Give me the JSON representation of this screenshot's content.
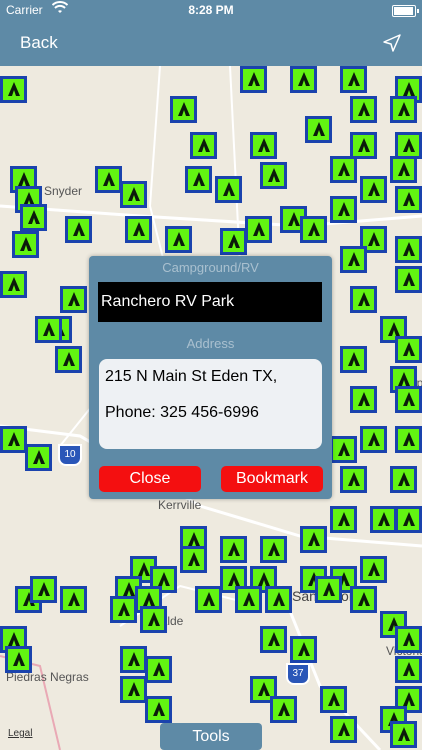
{
  "status_bar": {
    "carrier": "Carrier",
    "time": "8:28 PM",
    "battery_level": 0.95
  },
  "nav": {
    "back_label": "Back",
    "location_icon": "location-arrow-icon"
  },
  "map": {
    "labels": {
      "snyder": "Snyder",
      "kerrville": "Kerrville",
      "uvalde": "Uvalde",
      "san_antonio": "San Antonio",
      "piedras_negras": "Piedras Negras",
      "victoria": "Victoria",
      "temple": "Temple",
      "i10": "10",
      "us37": "37"
    },
    "pin_icon": "campground-tent-icon",
    "colors": {
      "pin_fill": "#62f312",
      "pin_border": "#1a43ad",
      "map_bg": "#eeeadf"
    }
  },
  "dialog": {
    "campground_caption": "Campground/RV",
    "campground_name": "Ranchero RV Park",
    "address_caption": "Address",
    "address_line1": "215 N Main St Eden  TX,",
    "address_line2": "Phone: 325 456-6996",
    "close_label": "Close",
    "bookmark_label": "Bookmark",
    "colors": {
      "panel": "#5e8aa6",
      "button": "#f40f10"
    }
  },
  "legal_label": "Legal",
  "tools_label": "Tools"
}
